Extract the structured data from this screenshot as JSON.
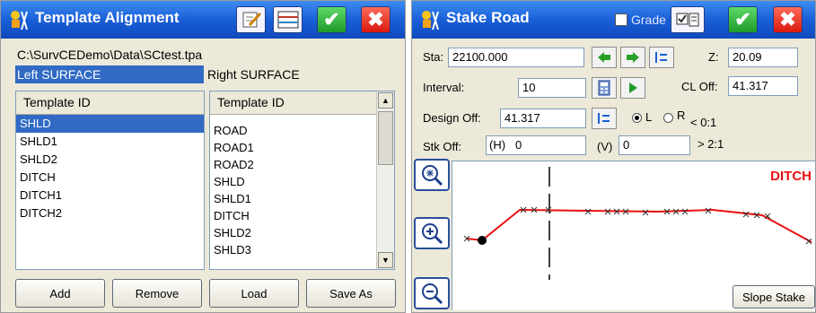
{
  "template_alignment": {
    "title": "Template Alignment",
    "file_path": "C:\\SurvCEDemo\\Data\\SCtest.tpa",
    "left_surface_label": "Left SURFACE",
    "right_surface_label": "Right SURFACE",
    "left_list": {
      "header": "Template ID",
      "items": [
        "SHLD",
        "SHLD1",
        "SHLD2",
        "DITCH",
        "DITCH1",
        "DITCH2"
      ]
    },
    "right_list": {
      "header": "Template ID",
      "items": [
        "ROAD",
        "ROAD1",
        "ROAD2",
        "SHLD",
        "SHLD1",
        "DITCH",
        "SHLD2",
        "SHLD3"
      ]
    },
    "buttons": {
      "add": "Add",
      "remove": "Remove",
      "load": "Load",
      "save_as": "Save As"
    }
  },
  "stake_road": {
    "title": "Stake Road",
    "grade_label": "Grade",
    "sta_label": "Sta:",
    "sta_value": "22100.000",
    "z_label": "Z:",
    "z_value": "20.09",
    "interval_label": "Interval:",
    "interval_value": "10",
    "cl_off_label": "CL Off:",
    "cl_off_value": "41.317",
    "design_off_label": "Design Off:",
    "design_off_value": "41.317",
    "side_left": "L",
    "side_right": "R",
    "slope_cut": "< 0:1",
    "slope_fill": "> 2:1",
    "stk_off_label": "Stk Off:",
    "h_label": "(H)",
    "h_value": "0",
    "v_label": "(V)",
    "v_value": "0",
    "profile_label": "DITCH",
    "slope_stake_button": "Slope Stake"
  },
  "colors": {
    "title_blue": "#1a5fd8",
    "selection_blue": "#316ac5",
    "profile_red": "#e81010",
    "ok_green": "#1e9a2b",
    "close_red": "#d9190c"
  }
}
